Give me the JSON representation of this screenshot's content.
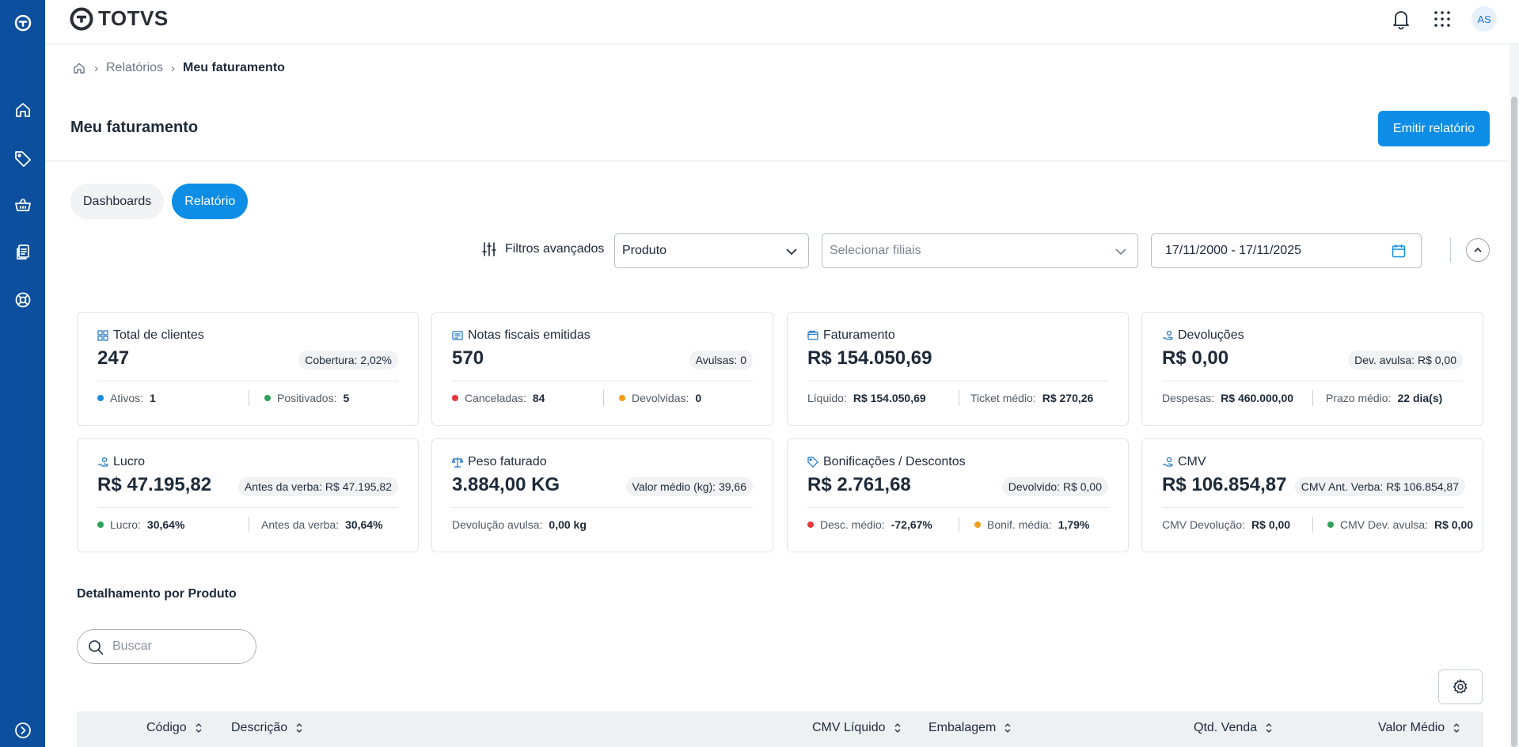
{
  "app": {
    "logo_text": "TOTVS"
  },
  "header": {
    "avatar_initials": "AS"
  },
  "breadcrumb": {
    "items": [
      "Relatórios",
      "Meu faturamento"
    ]
  },
  "page": {
    "title": "Meu faturamento",
    "emit_label": "Emitir relatório"
  },
  "tabs": [
    {
      "label": "Dashboards"
    },
    {
      "label": "Relatório"
    }
  ],
  "filters": {
    "advanced_label": "Filtros avançados",
    "group_by": "Produto",
    "branches_placeholder": "Selecionar filiais",
    "date_range": "17/11/2000 - 17/11/2025"
  },
  "cards": {
    "clients": {
      "title": "Total de clientes",
      "value": "247",
      "badge": "Cobertura: 2,02%",
      "f1_label": "Ativos:",
      "f1_value": "1",
      "f2_label": "Positivados:",
      "f2_value": "5"
    },
    "invoices": {
      "title": "Notas fiscais emitidas",
      "value": "570",
      "badge": "Avulsas: 0",
      "f1_label": "Canceladas:",
      "f1_value": "84",
      "f2_label": "Devolvidas:",
      "f2_value": "0"
    },
    "billing": {
      "title": "Faturamento",
      "value": "R$ 154.050,69",
      "f1_label": "Líquido:",
      "f1_value": "R$ 154.050,69",
      "f2_label": "Ticket médio:",
      "f2_value": "R$ 270,26"
    },
    "returns": {
      "title": "Devoluções",
      "value": "R$ 0,00",
      "badge": "Dev. avulsa: R$ 0,00",
      "f1_label": "Despesas:",
      "f1_value": "R$ 460.000,00",
      "f2_label": "Prazo médio:",
      "f2_value": "22 dia(s)"
    },
    "profit": {
      "title": "Lucro",
      "value": "R$ 47.195,82",
      "badge": "Antes da verba: R$ 47.195,82",
      "f1_label": "Lucro:",
      "f1_value": "30,64%",
      "f2_label": "Antes da verba:",
      "f2_value": "30,64%"
    },
    "weight": {
      "title": "Peso faturado",
      "value": "3.884,00 KG",
      "badge": "Valor médio (kg): 39,66",
      "f1_label": "Devolução avulsa:",
      "f1_value": "0,00 kg"
    },
    "bonus": {
      "title": "Bonificações / Descontos",
      "value": "R$ 2.761,68",
      "badge": "Devolvido: R$ 0,00",
      "f1_label": "Desc. médio:",
      "f1_value": "-72,67%",
      "f2_label": "Bonif. média:",
      "f2_value": "1,79%"
    },
    "cmv": {
      "title": "CMV",
      "value": "R$ 106.854,87",
      "badge": "CMV Ant. Verba: R$ 106.854,87",
      "f1_label": "CMV Devolução:",
      "f1_value": "R$ 0,00",
      "f2_label": "CMV Dev. avulsa:",
      "f2_value": "R$ 0,00"
    }
  },
  "detail": {
    "title": "Detalhamento por Produto",
    "search_placeholder": "Buscar",
    "columns": [
      "Código",
      "Descrição",
      "CMV Líquido",
      "Embalagem",
      "Qtd. Venda",
      "Valor Médio"
    ]
  },
  "colors": {
    "primary": "#0d8de6",
    "sidebar": "#0c4f9e",
    "dot_blue": "#1a8be0",
    "dot_green": "#2ea45a",
    "dot_red": "#e5383b",
    "dot_orange": "#f29d1b"
  }
}
